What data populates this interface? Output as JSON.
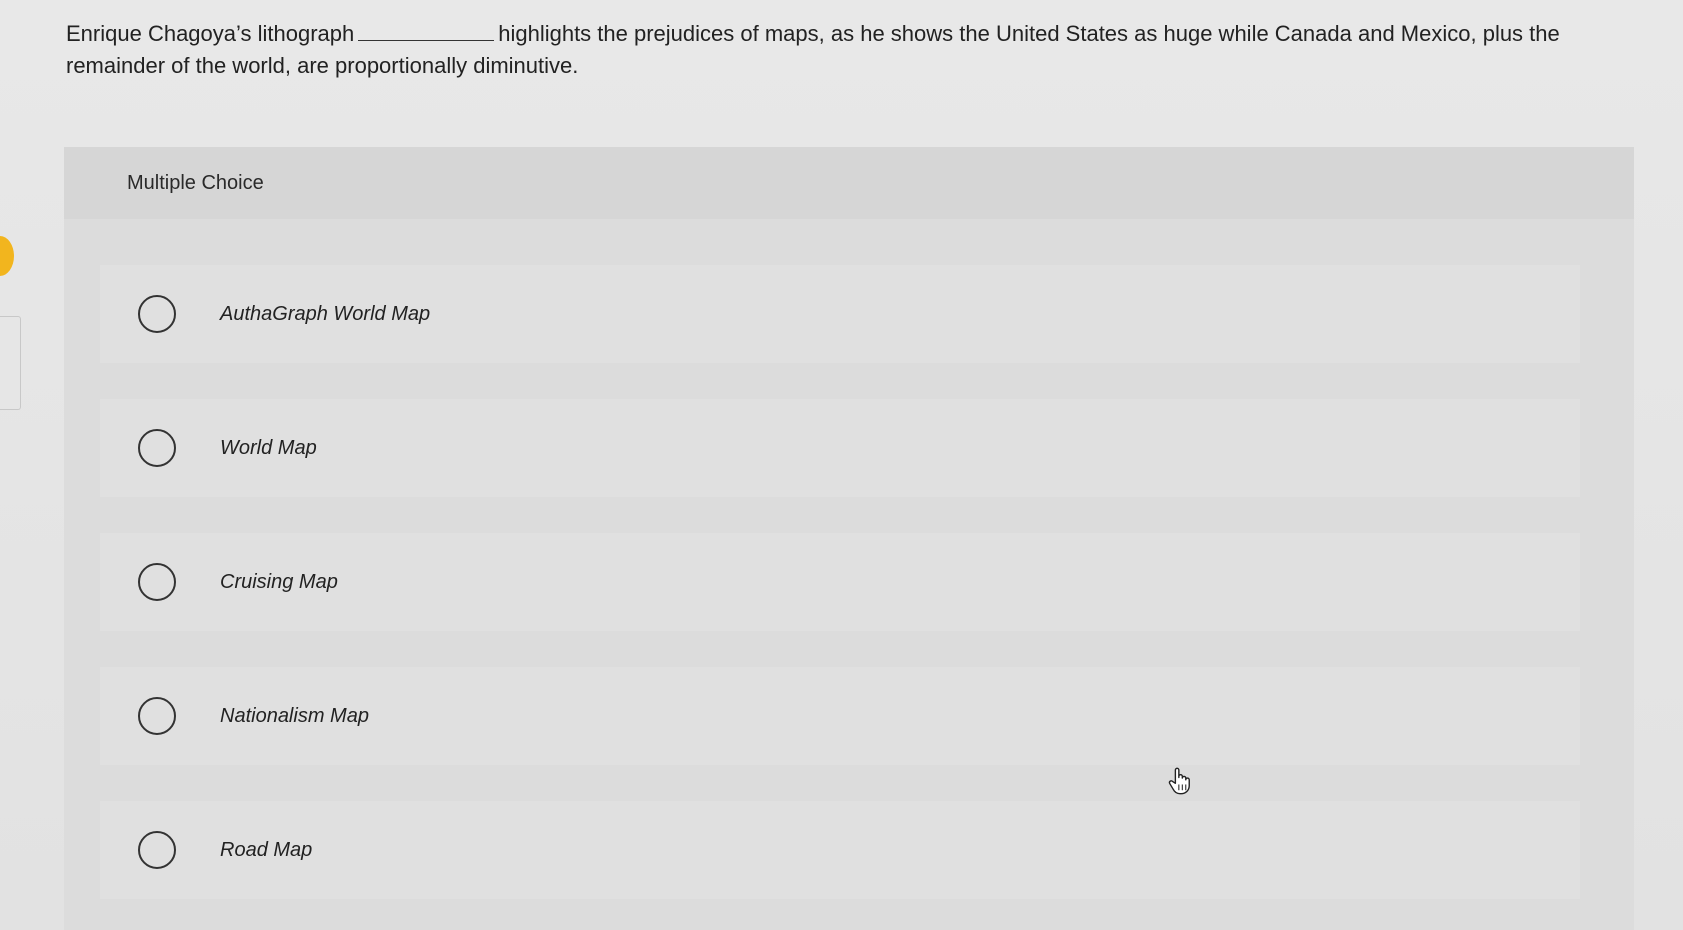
{
  "question": {
    "text_before": "Enrique Chagoya’s lithograph",
    "text_after": "highlights the prejudices of maps, as he shows the United States as huge while Canada and Mexico, plus the remainder of the world, are proportionally diminutive."
  },
  "card": {
    "header": "Multiple Choice",
    "options": [
      {
        "label": "AuthaGraph World Map",
        "selected": false
      },
      {
        "label": "World Map",
        "selected": false
      },
      {
        "label": "Cruising Map",
        "selected": false
      },
      {
        "label": "Nationalism Map",
        "selected": false
      },
      {
        "label": "Road Map",
        "selected": false
      }
    ]
  },
  "icons": {
    "radio": "radio-unchecked-icon",
    "cursor": "hand-pointer-icon"
  },
  "colors": {
    "accent_marker": "#f2b51e",
    "card_bg": "#dcdcdc",
    "option_bg": "#e0e0e0"
  }
}
